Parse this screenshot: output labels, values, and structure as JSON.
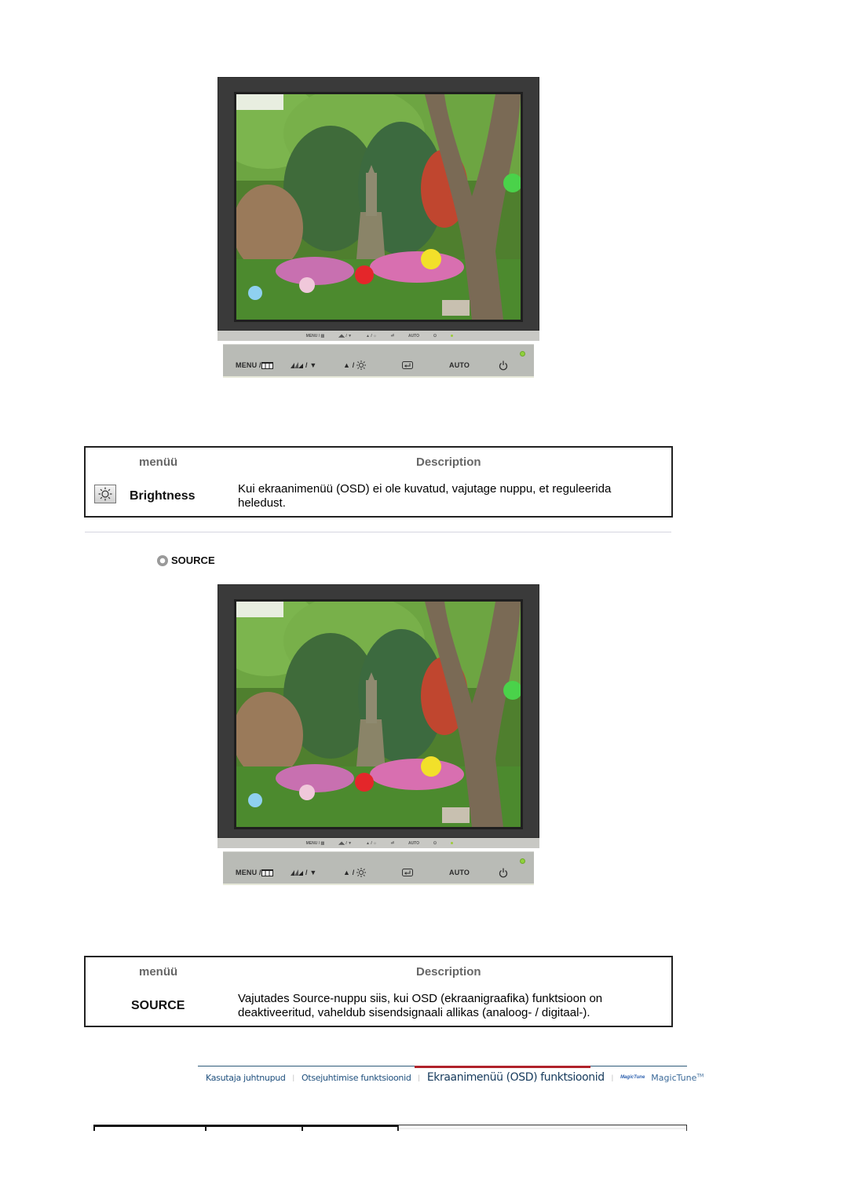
{
  "monitor": {
    "strip_labels": [
      "MENU / ▥",
      "◢◣ / ▼",
      "▲ / ☼",
      "⏎",
      "AUTO",
      "⏻"
    ],
    "panel_buttons": [
      {
        "name": "menu-button",
        "label": "MENU / ",
        "icon": "menu-grid-icon"
      },
      {
        "name": "magicbright-down-button",
        "label": "/ ▼",
        "icon": "magicbright-icon"
      },
      {
        "name": "up-brightness-button",
        "label": "▲ /",
        "icon": "brightness-icon"
      },
      {
        "name": "enter-source-button",
        "label": "",
        "icon": "enter-icon"
      },
      {
        "name": "auto-button",
        "label": "AUTO",
        "icon": ""
      },
      {
        "name": "power-button",
        "label": "",
        "icon": "power-icon"
      }
    ],
    "power_led_color": "#8fd13c"
  },
  "brightness_table": {
    "header_menu": "menüü",
    "header_description": "Description",
    "item_icon": "brightness-sun-icon",
    "item_name": "Brightness",
    "description": "Kui ekraanimenüü (OSD) ei ole kuvatud, vajutage nuppu, et reguleerida heledust."
  },
  "source_section": {
    "heading": "SOURCE",
    "bullet_icon": "circle-bullet-icon"
  },
  "source_table": {
    "header_menu": "menüü",
    "header_description": "Description",
    "item_name": "SOURCE",
    "description": "Vajutades Source-nuppu siis, kui OSD (ekraanigraafika) funktsioon on deaktiveeritud, vaheldub sisendsignaali allikas (analoog- / digitaal-)."
  },
  "bottom_nav": {
    "items": [
      {
        "label": "Kasutaja juhtnupud",
        "active": false
      },
      {
        "label": "Otsejuhtimise funktsioonid",
        "active": false
      },
      {
        "label": "Ekraanimenüü (OSD) funktsioonid",
        "active": true
      }
    ],
    "magictune_logo": "MagicTune",
    "magictune_label": "MagicTune",
    "magictune_tm": "TM",
    "active_color": "#b0222a",
    "link_color": "#1e4f7d"
  }
}
